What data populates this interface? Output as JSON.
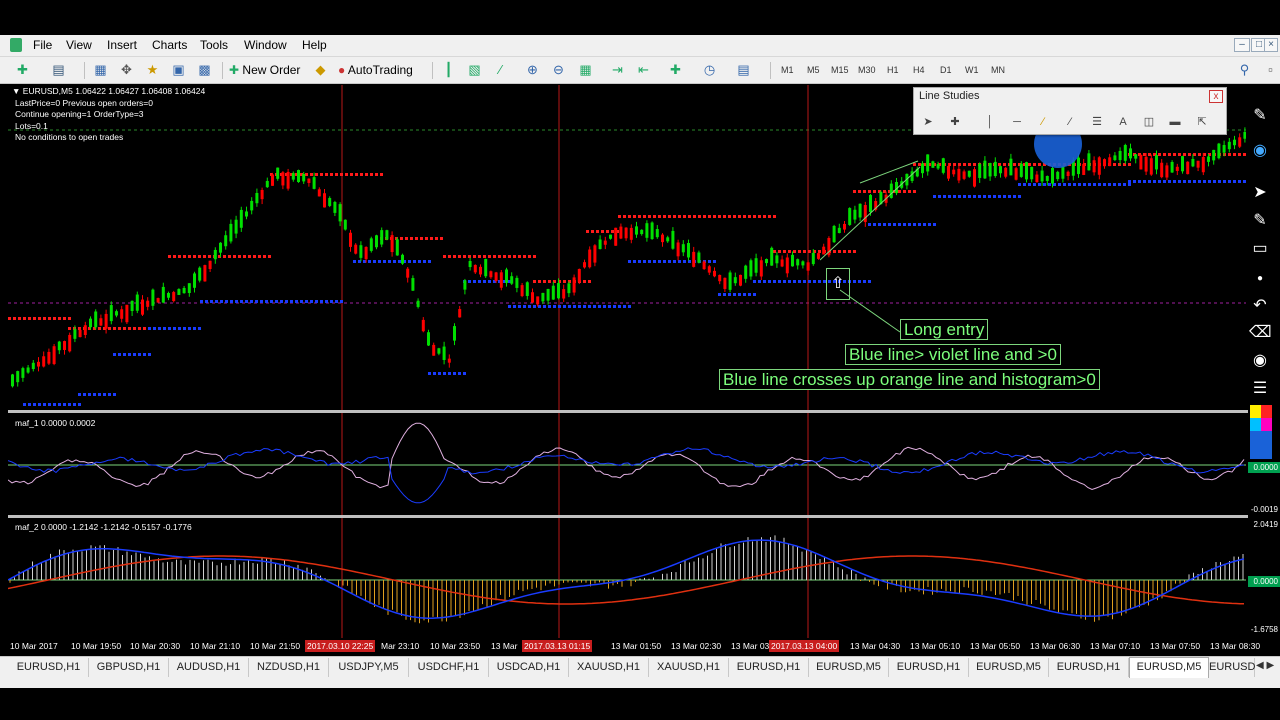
{
  "menu": {
    "items": [
      "File",
      "View",
      "Insert",
      "Charts",
      "Tools",
      "Window",
      "Help"
    ]
  },
  "toolbar": {
    "new_order": "New Order",
    "auto_trading": "AutoTrading",
    "timeframes": [
      "M1",
      "M5",
      "M15",
      "M30",
      "H1",
      "H4",
      "D1",
      "W1",
      "MN"
    ]
  },
  "chart": {
    "symbol_line": "EURUSD,M5  1.06422 1.06427 1.06408 1.06424",
    "info_lines": [
      "LastPrice=0 Previous open orders=0",
      "Continue opening=1 OrderType=3",
      "Lots=0.1",
      "No conditions to open trades"
    ],
    "indicator1_label": "maf_1 0.0000 0.0002",
    "indicator2_label": "maf_2 0.0000 -1.2142 -1.2142 -0.5157 -0.1776",
    "colors": {
      "bull_candle": "#00e000",
      "bear_candle": "#ff0000",
      "resistance_dots": "#ff1a1a",
      "support_dots": "#1a3cff",
      "osc_blue": "#1a3cff",
      "osc_pink": "#e0b0e0",
      "signal_red": "#e03010",
      "histogram_pos": "#d0d0d0",
      "histogram_neg": "#e0a020"
    }
  },
  "price_axis": {
    "ind1": [
      "0.0000",
      "-0.0019"
    ],
    "ind2": [
      "2.0419",
      "0.0000",
      "-1.6758"
    ]
  },
  "time_axis": {
    "labels": [
      "10 Mar 2017",
      "10 Mar 19:50",
      "10 Mar 20:30",
      "10 Mar 21:10",
      "10 Mar 21:50",
      "Mar 23:10",
      "10 Mar 23:50",
      "13 Mar",
      "13 Mar 01:50",
      "13 Mar 02:30",
      "13 Mar 03",
      "13 Mar 04:30",
      "13 Mar 05:10",
      "13 Mar 05:50",
      "13 Mar 06:30",
      "13 Mar 07:10",
      "13 Mar 07:50",
      "13 Mar 08:30"
    ],
    "highlights": [
      "2017.03.10 22:25",
      "2017.03.13 01:15",
      "2017.03.13 04:00"
    ]
  },
  "annotations": {
    "long_entry": "Long entry",
    "blue_violet": "Blue line> violet line and >0",
    "blue_orange": "Blue line crosses up orange line and histogram>0"
  },
  "line_studies": {
    "title": "Line Studies",
    "close": "x"
  },
  "tabs": [
    "EURUSD,H1",
    "GBPUSD,H1",
    "AUDUSD,H1",
    "NZDUSD,H1",
    "USDJPY,M5",
    "USDCHF,H1",
    "USDCAD,H1",
    "XAUUSD,H1",
    "XAUUSD,H1",
    "EURUSD,H1",
    "EURUSD,M5",
    "EURUSD,H1",
    "EURUSD,M5",
    "EURUSD,H1",
    "EURUSD,M5",
    "EURUSD"
  ],
  "active_tab": "EURUSD,M5"
}
